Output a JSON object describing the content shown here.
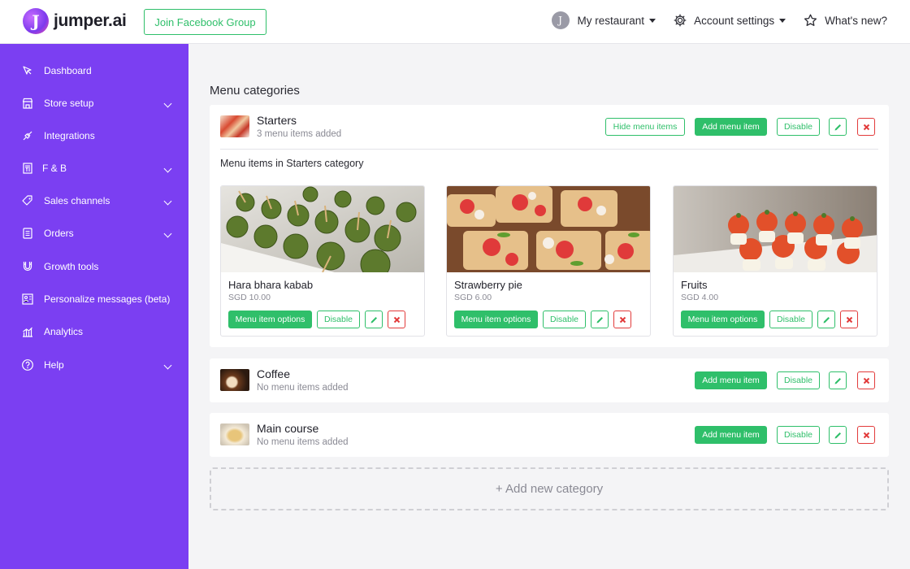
{
  "brand": {
    "logo_letter": "J",
    "name": "jumper.ai"
  },
  "header": {
    "facebook_button": "Join Facebook Group",
    "avatar_letter": "J",
    "restaurant_menu": "My restaurant",
    "account_settings": "Account settings",
    "whats_new": "What's new?"
  },
  "sidebar": {
    "items": [
      {
        "label": "Dashboard",
        "icon": "dashboard-icon"
      },
      {
        "label": "Store setup",
        "icon": "store-icon"
      },
      {
        "label": "Integrations",
        "icon": "integrations-icon"
      },
      {
        "label": "F & B",
        "icon": "fnb-icon"
      },
      {
        "label": "Sales channels",
        "icon": "sales-channels-icon"
      },
      {
        "label": "Orders",
        "icon": "orders-icon"
      },
      {
        "label": "Growth tools",
        "icon": "magnet-icon"
      },
      {
        "label": "Personalize messages (beta)",
        "icon": "personalize-icon"
      },
      {
        "label": "Analytics",
        "icon": "analytics-icon"
      },
      {
        "label": "Help",
        "icon": "help-icon"
      }
    ]
  },
  "main": {
    "title": "Menu categories",
    "add_category": "+ Add new category",
    "categories": [
      {
        "name": "Starters",
        "subtitle": "3 menu items added",
        "hide_items": "Hide menu items",
        "add_item": "Add menu item",
        "disable": "Disable",
        "items_heading": "Menu items in Starters category",
        "items": [
          {
            "name": "Hara bhara kabab",
            "price": "SGD 10.00",
            "options": "Menu item options",
            "disable": "Disable"
          },
          {
            "name": "Strawberry pie",
            "price": "SGD 6.00",
            "options": "Menu item options",
            "disable": "Disable"
          },
          {
            "name": "Fruits",
            "price": "SGD 4.00",
            "options": "Menu item options",
            "disable": "Disable"
          }
        ]
      },
      {
        "name": "Coffee",
        "subtitle": "No menu items added",
        "add_item": "Add menu item",
        "disable": "Disable"
      },
      {
        "name": "Main course",
        "subtitle": "No menu items added",
        "add_item": "Add menu item",
        "disable": "Disable"
      }
    ]
  },
  "colors": {
    "sidebar": "#7b3ff2",
    "accent_green": "#2fbf6a",
    "danger_red": "#e23b3b"
  }
}
